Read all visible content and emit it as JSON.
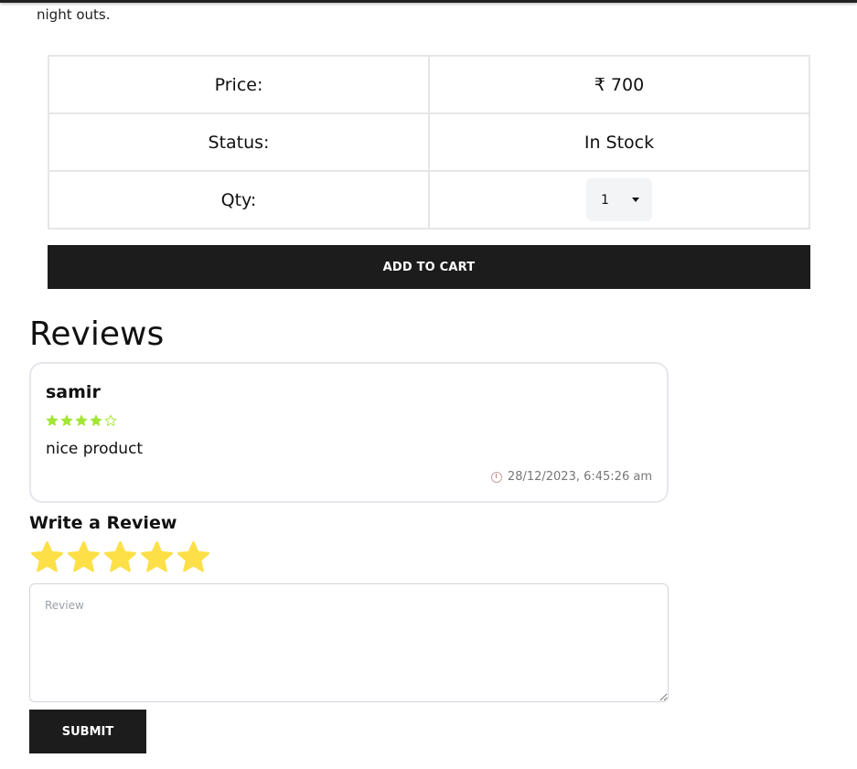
{
  "product": {
    "description_tail": "night outs.",
    "price_label": "Price:",
    "price_value": "₹ 700",
    "status_label": "Status:",
    "status_value": "In Stock",
    "qty_label": "Qty:",
    "qty_selected": "1",
    "add_to_cart_label": "ADD TO CART"
  },
  "reviews": {
    "heading": "Reviews",
    "items": [
      {
        "name": "samir",
        "rating": 4,
        "max_rating": 5,
        "comment": "nice product",
        "date": "28/12/2023, 6:45:26 am",
        "star_color": "#a3e635"
      }
    ]
  },
  "write_review": {
    "heading": "Write a Review",
    "rating": 5,
    "max_rating": 5,
    "star_color": "#fde047",
    "placeholder": "Review",
    "submit_label": "SUBMIT"
  }
}
